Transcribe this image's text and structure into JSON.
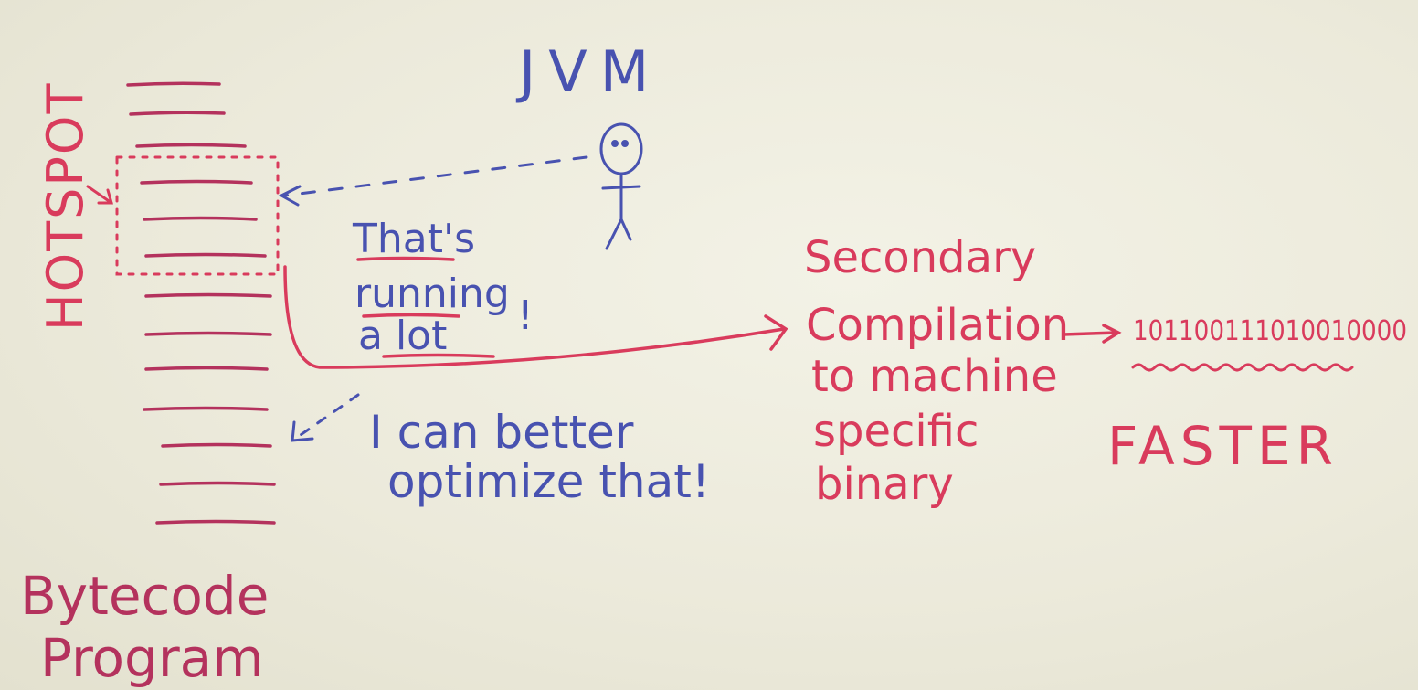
{
  "labels": {
    "jvm": "JVM",
    "hotspot": "HOTSPOT",
    "bytecode_line1": "Bytecode",
    "bytecode_line2": "Program",
    "thats": "That's",
    "running": "running",
    "a_lot": "a lot",
    "exclaim": "!",
    "optimize_line1": "I can better",
    "optimize_line2": "optimize that!",
    "secondary_line1": "Secondary",
    "secondary_line2": "Compilation",
    "secondary_line3": "to machine",
    "secondary_line4": "specific",
    "secondary_line5": "binary",
    "binary_digits": "101100111010010000",
    "faster": "FASTER"
  },
  "colors": {
    "red": "#d93b5c",
    "magenta": "#b4325d",
    "blue": "#4852b0",
    "background": "#eceadb"
  }
}
